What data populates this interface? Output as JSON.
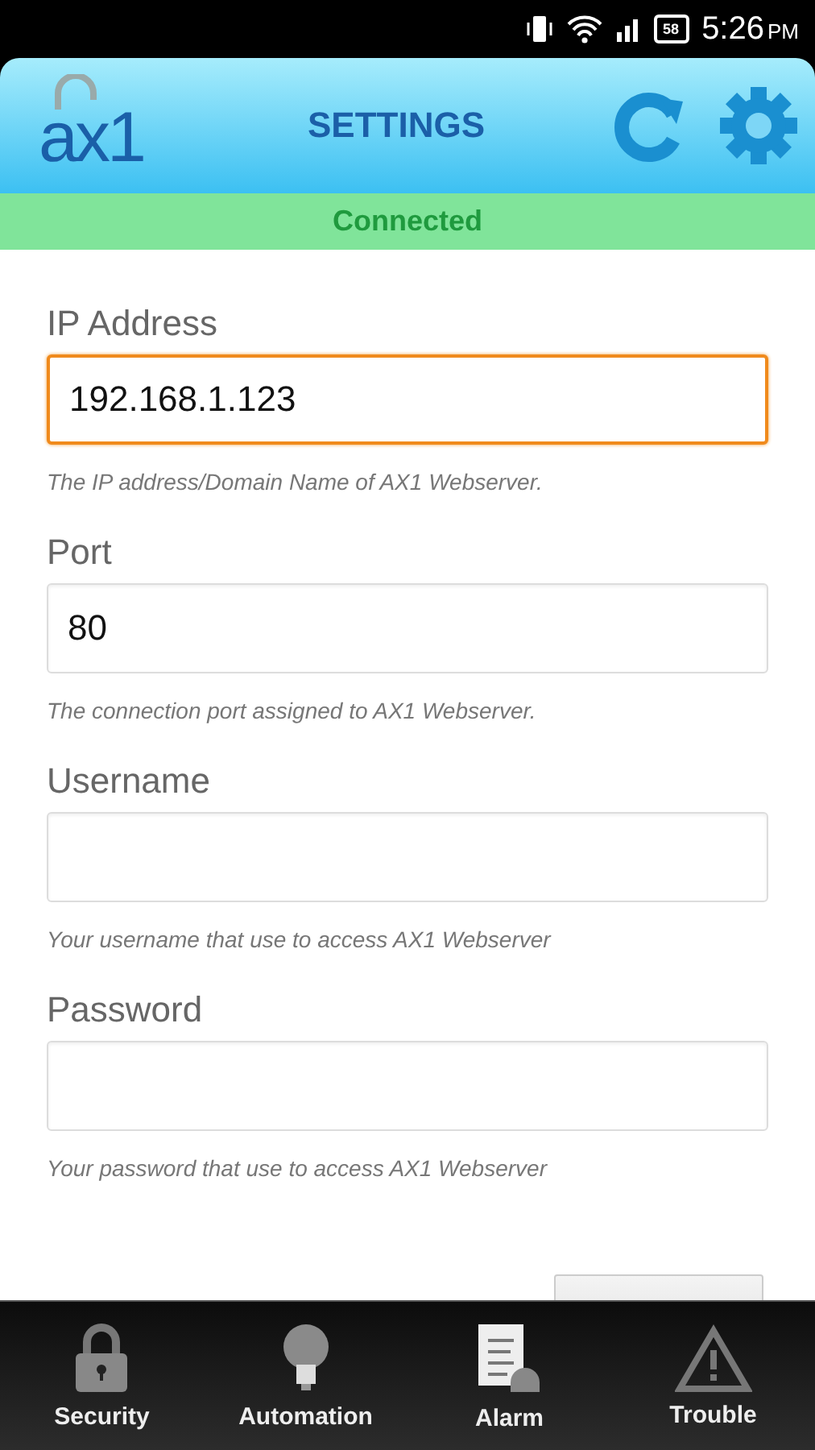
{
  "status_bar": {
    "battery": "58",
    "time": "5:26",
    "ampm": "PM"
  },
  "header": {
    "logo": "ax1",
    "title": "SETTINGS"
  },
  "connection": {
    "text": "Connected"
  },
  "fields": [
    {
      "label": "IP Address",
      "value": "192.168.1.123",
      "focused": true,
      "help": "The IP address/Domain Name of AX1 Webserver."
    },
    {
      "label": "Port",
      "value": "80",
      "focused": false,
      "help": "The connection port assigned to AX1 Webserver."
    },
    {
      "label": "Username",
      "focused": false,
      "help": "Your username that use to access AX1 Webserver"
    },
    {
      "label": "Password",
      "focused": false,
      "help": "Your password that use to access AX1 Webserver"
    }
  ],
  "tabs": [
    {
      "label": "Security",
      "kind": "lock"
    },
    {
      "label": "Automation",
      "kind": "bulb"
    },
    {
      "label": "Alarm",
      "kind": "alarm"
    },
    {
      "label": "Trouble",
      "kind": "warning"
    }
  ]
}
